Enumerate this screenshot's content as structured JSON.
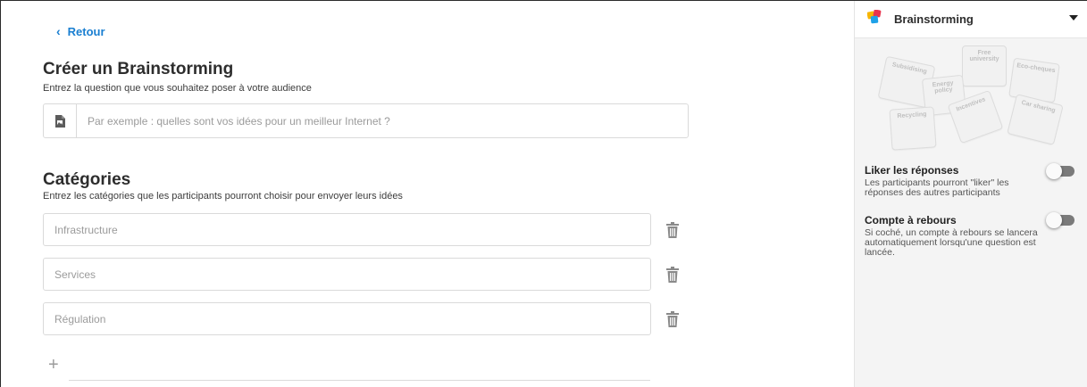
{
  "main": {
    "back_label": "Retour",
    "question_title": "Créer un Brainstorming",
    "question_subtitle": "Entrez la question que vous souhaitez poser à votre audience",
    "question_placeholder": "Par exemple : quelles sont vos idées pour un meilleur Internet ?",
    "categories_title": "Catégories",
    "categories_subtitle": "Entrez les catégories que les participants pourront choisir pour envoyer leurs idées",
    "categories": [
      {
        "placeholder": "Infrastructure"
      },
      {
        "placeholder": "Services"
      },
      {
        "placeholder": "Régulation"
      }
    ],
    "add_label": "+"
  },
  "sidebar": {
    "activity_name": "Brainstorming",
    "illustration_notes": [
      "Subsidising",
      "Free university",
      "Eco-cheques",
      "Energy policy",
      "Recycling",
      "Incentives",
      "Car sharing"
    ],
    "options": [
      {
        "title": "Liker les réponses",
        "description": "Les participants pourront \"liker\" les réponses des autres participants",
        "enabled": false
      },
      {
        "title": "Compte à rebours",
        "description": "Si coché, un compte à rebours se lancera automatiquement lorsqu'une question est lancée.",
        "enabled": false
      }
    ]
  },
  "colors": {
    "accent": "#1a7fd1",
    "toggle_off": "#7a7a7a",
    "sidebar_bg": "#f4f4f4"
  },
  "icons": {
    "back": "chevron-left-icon",
    "question": "image-file-icon",
    "delete": "trash-icon",
    "dropdown": "caret-down-icon",
    "logo": "app-logo-icon"
  }
}
